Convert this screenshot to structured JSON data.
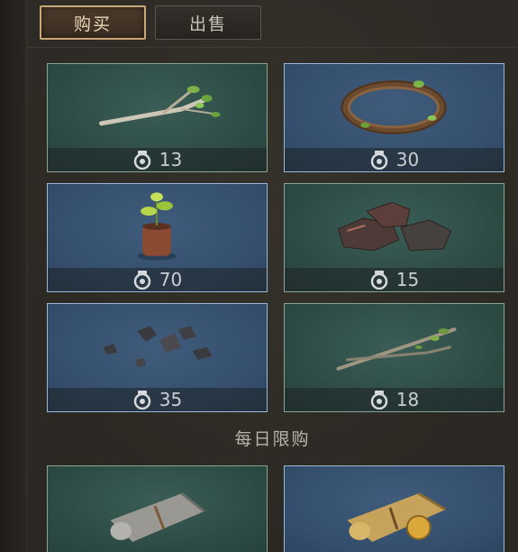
{
  "tabs": [
    {
      "label": "购买",
      "active": true
    },
    {
      "label": "出售",
      "active": false
    }
  ],
  "items": [
    {
      "name": "twig",
      "price": "13",
      "bg": "green"
    },
    {
      "name": "vine-wreath",
      "price": "30",
      "bg": "blue"
    },
    {
      "name": "potted-sapling",
      "price": "70",
      "bg": "blue"
    },
    {
      "name": "iron-ore",
      "price": "15",
      "bg": "green"
    },
    {
      "name": "ore-fragments",
      "price": "35",
      "bg": "blue"
    },
    {
      "name": "branches",
      "price": "18",
      "bg": "green"
    }
  ],
  "daily_section": {
    "title": "每日限购",
    "items": [
      {
        "name": "grey-scroll",
        "bg": "green"
      },
      {
        "name": "gold-scroll-with-coin",
        "bg": "blue"
      }
    ]
  },
  "colors": {
    "tab_active_border": "#c9a876",
    "card_green": "#2c4a44",
    "card_blue": "#344e6c",
    "price_text": "#c9ccd0"
  }
}
